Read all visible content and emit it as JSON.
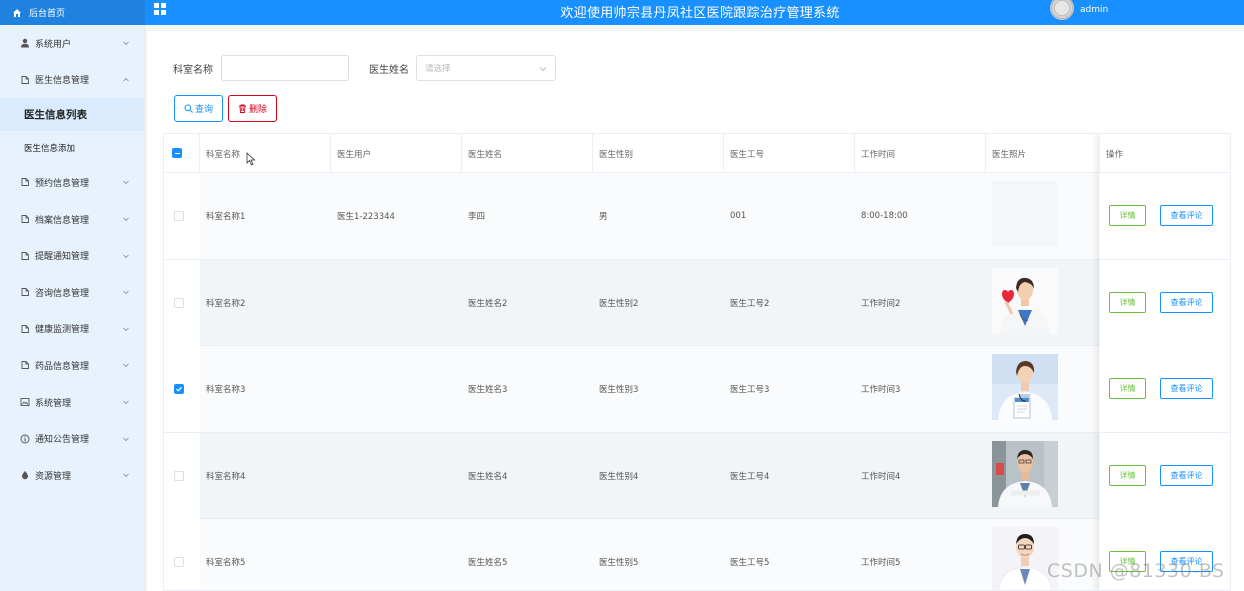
{
  "header": {
    "home_label": "后台首页",
    "system_title": "欢迎使用帅宗县丹凤社区医院跟踪治疗管理系统",
    "username": "admin"
  },
  "sidebar": {
    "items": [
      {
        "label": "系统用户",
        "icon": "user-icon"
      },
      {
        "label": "医生信息管理",
        "icon": "clipboard-icon",
        "expanded": true
      },
      {
        "label": "预约信息管理",
        "icon": "clipboard-icon"
      },
      {
        "label": "档案信息管理",
        "icon": "clipboard-icon"
      },
      {
        "label": "提醒通知管理",
        "icon": "clipboard-icon"
      },
      {
        "label": "咨询信息管理",
        "icon": "clipboard-icon"
      },
      {
        "label": "健康监测管理",
        "icon": "clipboard-icon"
      },
      {
        "label": "药品信息管理",
        "icon": "clipboard-icon"
      },
      {
        "label": "系统管理",
        "icon": "picture-icon"
      },
      {
        "label": "通知公告管理",
        "icon": "info-icon"
      },
      {
        "label": "资源管理",
        "icon": "drop-icon"
      }
    ],
    "sub_items": [
      {
        "label": "医生信息列表",
        "active": true
      },
      {
        "label": "医生信息添加",
        "active": false
      }
    ]
  },
  "filters": {
    "dept_label": "科室名称",
    "dept_value": "",
    "doctor_label": "医生姓名",
    "doctor_placeholder": "请选择",
    "query_label": "查询",
    "delete_label": "删除"
  },
  "table": {
    "columns": [
      "科室名称",
      "医生用户",
      "医生姓名",
      "医生性别",
      "医生工号",
      "工作时间",
      "医生照片",
      "操作"
    ],
    "detail_label": "详情",
    "comment_label": "查看评论",
    "rows": [
      {
        "dept": "科室名称1",
        "user": "医生1-223344",
        "name": "李四",
        "gender": "男",
        "number": "001",
        "time": "8:00-18:00",
        "checked": false,
        "photo": "none"
      },
      {
        "dept": "科室名称2",
        "user": "",
        "name": "医生姓名2",
        "gender": "医生性别2",
        "number": "医生工号2",
        "time": "工作时间2",
        "checked": false,
        "photo": "female-doctor-heart"
      },
      {
        "dept": "科室名称3",
        "user": "",
        "name": "医生姓名3",
        "gender": "医生性别3",
        "number": "医生工号3",
        "time": "工作时间3",
        "checked": true,
        "photo": "female-doctor-clipboard"
      },
      {
        "dept": "科室名称4",
        "user": "",
        "name": "医生姓名4",
        "gender": "医生性别4",
        "number": "医生工号4",
        "time": "工作时间4",
        "checked": false,
        "photo": "male-doctor-hallway"
      },
      {
        "dept": "科室名称5",
        "user": "",
        "name": "医生姓名5",
        "gender": "医生性别5",
        "number": "医生工号5",
        "time": "工作时间5",
        "checked": false,
        "photo": "male-doctor-glasses"
      }
    ]
  },
  "watermark": "CSDN @81330-BS",
  "colors": {
    "primary": "#1890ff",
    "danger": "#d9001b",
    "success": "#67c23a",
    "sidebar_bg": "#e8f2fd"
  }
}
